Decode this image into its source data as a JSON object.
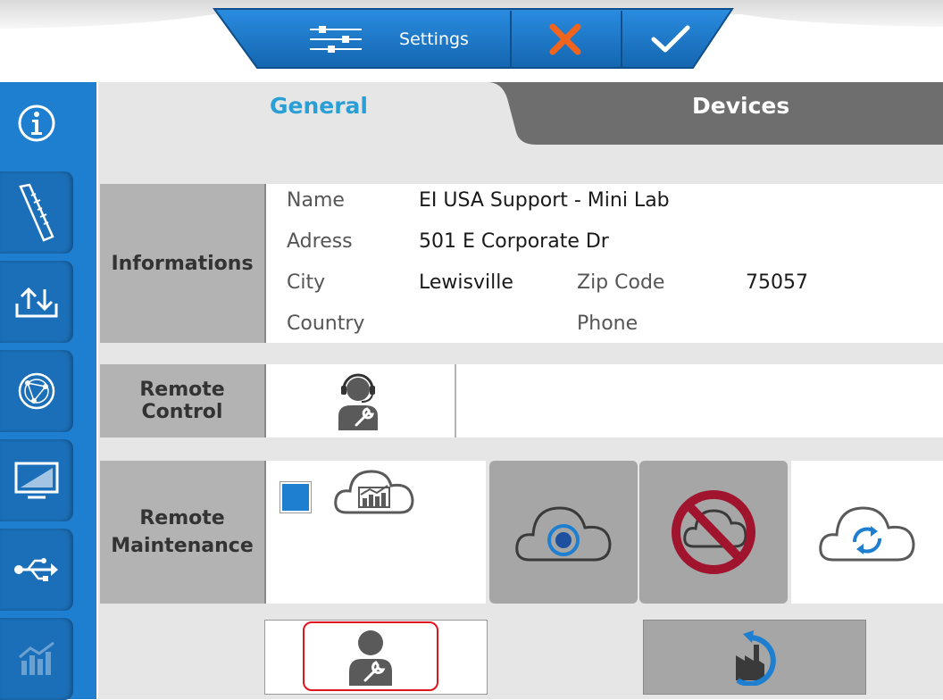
{
  "header": {
    "settings_label": "Settings",
    "cancel_icon": "close-icon",
    "confirm_icon": "check-icon",
    "accent": "#1e7fd0",
    "cancel_color": "#f0641e"
  },
  "sidebar": {
    "items": [
      {
        "icon": "info-icon"
      },
      {
        "icon": "ruler-icon"
      },
      {
        "icon": "import-export-icon"
      },
      {
        "icon": "network-icon"
      },
      {
        "icon": "monitor-icon"
      },
      {
        "icon": "usb-icon"
      },
      {
        "icon": "chart-icon"
      }
    ]
  },
  "tabs": [
    {
      "label": "General",
      "active": true
    },
    {
      "label": "Devices",
      "active": false
    }
  ],
  "informations": {
    "header": "Informations",
    "name_label": "Name",
    "name_value": "EI USA Support - Mini Lab",
    "address_label": "Adress",
    "address_value": "501 E Corporate Dr",
    "city_label": "City",
    "city_value": "Lewisville",
    "zip_label": "Zip Code",
    "zip_value": "75057",
    "country_label": "Country",
    "phone_label": "Phone"
  },
  "remote_control": {
    "header": "Remote Control",
    "icon": "support-agent-icon"
  },
  "remote_maintenance": {
    "header_line1": "Remote",
    "header_line2": "Maintenance",
    "checkbox_checked": true,
    "icons": [
      "cloud-chart-icon",
      "cloud-target-icon",
      "cloud-disabled-icon",
      "cloud-sync-icon"
    ]
  },
  "bottom": {
    "icons": [
      "service-technician-icon",
      "factory-reset-icon"
    ],
    "highlight_color": "#e0141e"
  }
}
